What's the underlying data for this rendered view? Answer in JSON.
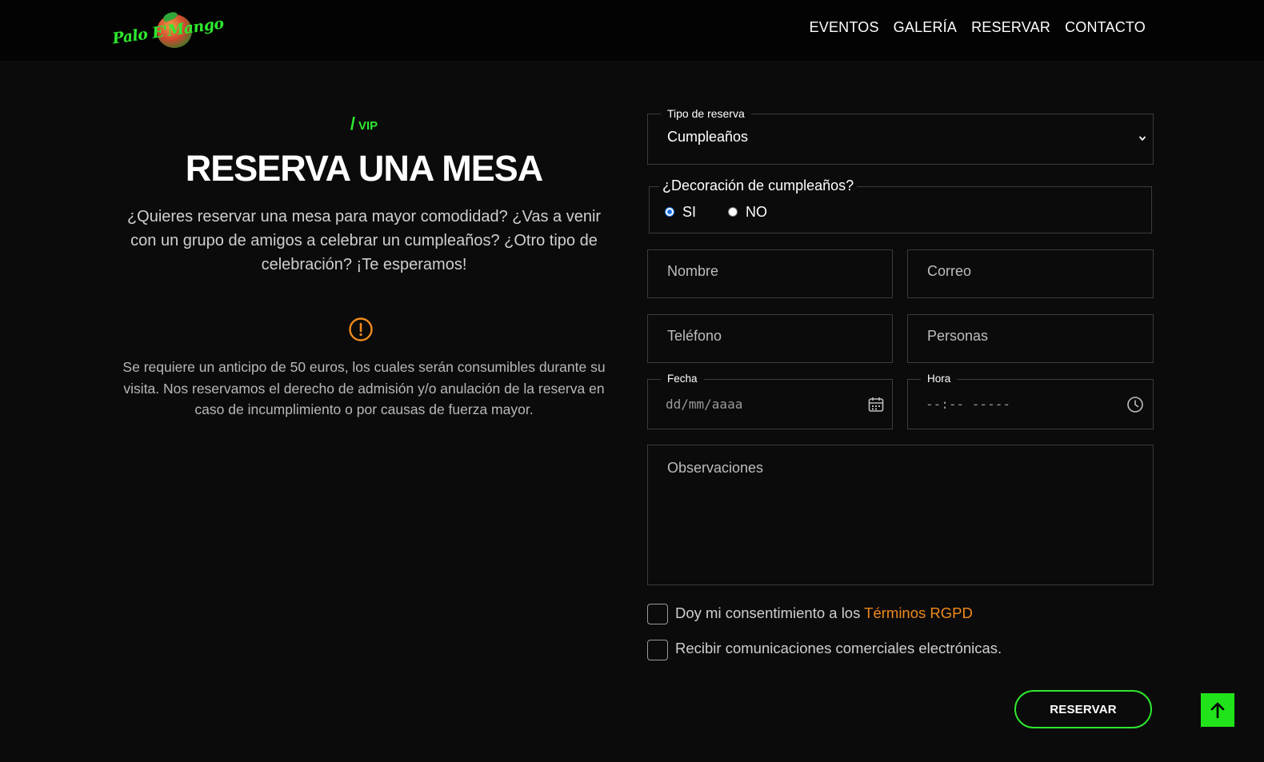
{
  "brand": {
    "logo_text": "Palo E'Mango"
  },
  "nav": {
    "items": [
      {
        "label": "EVENTOS"
      },
      {
        "label": "GALERÍA"
      },
      {
        "label": "RESERVAR"
      },
      {
        "label": "CONTACTO"
      }
    ]
  },
  "intro": {
    "kicker_slash": "/",
    "kicker": "VIP",
    "title": "RESERVA UNA MESA",
    "lead": "¿Quieres reservar una mesa para mayor comodidad? ¿Vas a venir con un grupo de amigos a celebrar un cumpleaños? ¿Otro tipo de celebración? ¡Te esperamos!",
    "notice": "Se requiere un anticipo de 50 euros, los cuales serán consumibles durante su visita. Nos reservamos el derecho de admisión y/o anulación de la reserva en caso de incumplimiento o por causas de fuerza mayor."
  },
  "form": {
    "reservation_type": {
      "legend": "Tipo de reserva",
      "value": "Cumpleaños"
    },
    "decoration": {
      "legend": "¿Decoración de cumpleaños?",
      "options": [
        {
          "label": "SI",
          "selected": true
        },
        {
          "label": "NO",
          "selected": false
        }
      ]
    },
    "name_placeholder": "Nombre",
    "email_placeholder": "Correo",
    "phone_placeholder": "Teléfono",
    "people_placeholder": "Personas",
    "date": {
      "legend": "Fecha",
      "placeholder": "dd/mm/aaaa"
    },
    "time": {
      "legend": "Hora",
      "placeholder": "--:-- -----"
    },
    "notes_placeholder": "Observaciones",
    "consent": {
      "label": "Doy mi consentimiento a los ",
      "link": "Términos RGPD",
      "checked": false
    },
    "marketing": {
      "label": "Recibir comunicaciones comerciales electrónicas.",
      "checked": false
    },
    "submit_label": "RESERVAR"
  },
  "colors": {
    "accent_green": "#2ee82e",
    "accent_orange": "#f08a1c",
    "background": "#0b0b0b",
    "radio_blue": "#1a73e8"
  },
  "icons": [
    "chevron-down-icon",
    "calendar-icon",
    "clock-icon",
    "alert-circle-icon",
    "arrow-up-icon"
  ]
}
